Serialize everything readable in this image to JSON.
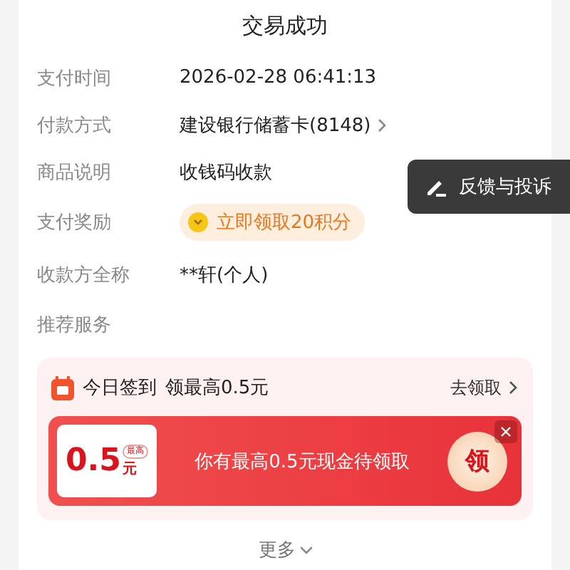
{
  "title": "交易成功",
  "details": [
    {
      "kind": "text",
      "label": "支付时间",
      "value": "2026-02-28 06:41:13"
    },
    {
      "kind": "link",
      "label": "付款方式",
      "value": "建设银行储蓄卡(8148)"
    },
    {
      "kind": "text",
      "label": "商品说明",
      "value": "收钱码收款"
    },
    {
      "kind": "reward",
      "label": "支付奖励",
      "value": "立即领取20积分"
    },
    {
      "kind": "text",
      "label": "收款方全称",
      "value": "**轩(个人)"
    },
    {
      "kind": "section",
      "label": "推荐服务"
    }
  ],
  "feedback_button": "反馈与投诉",
  "promo": {
    "title": "今日签到",
    "subtitle": "领最高0.5元",
    "action": "去领取",
    "coupon": {
      "amount": "0.5",
      "tag": "最高",
      "unit": "元",
      "message": "你有最高0.5元现金待领取",
      "claim": "领"
    }
  },
  "more": "更多"
}
